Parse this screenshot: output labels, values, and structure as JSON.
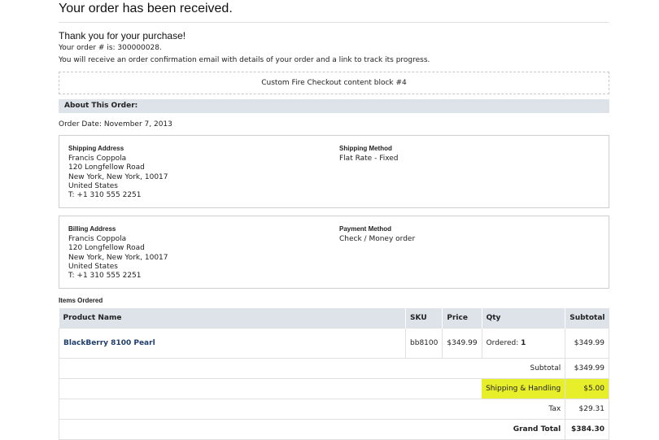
{
  "page": {
    "title": "Your order has been received.",
    "thanks": "Thank you for your purchase!",
    "order_line": "Your order # is: 300000028.",
    "email_line": "You will receive an order confirmation email with details of your order and a link to track its progress.",
    "content_block": "Custom Fire Checkout content block #4"
  },
  "about": {
    "heading": "About This Order:",
    "order_date": "Order Date: November 7, 2013"
  },
  "shipping": {
    "address_heading": "Shipping Address",
    "lines": [
      "Francis Coppola",
      "120 Longfellow Road",
      "New York, New York, 10017",
      "United States",
      "T: +1 310 555 2251"
    ],
    "method_heading": "Shipping Method",
    "method": "Flat Rate - Fixed"
  },
  "billing": {
    "address_heading": "Billing Address",
    "lines": [
      "Francis Coppola",
      "120 Longfellow Road",
      "New York, New York, 10017",
      "United States",
      "T: +1 310 555 2251"
    ],
    "method_heading": "Payment Method",
    "method": "Check / Money order"
  },
  "items": {
    "heading": "Items Ordered",
    "columns": {
      "product": "Product Name",
      "sku": "SKU",
      "price": "Price",
      "qty": "Qty",
      "subtotal": "Subtotal"
    },
    "rows": [
      {
        "product": "BlackBerry 8100 Pearl",
        "sku": "bb8100",
        "price": "$349.99",
        "qty_label": "Ordered:",
        "qty_value": "1",
        "subtotal": "$349.99"
      }
    ],
    "totals": {
      "subtotal_label": "Subtotal",
      "subtotal_value": "$349.99",
      "shipping_label": "Shipping & Handling",
      "shipping_value": "$5.00",
      "tax_label": "Tax",
      "tax_value": "$29.31",
      "grand_label": "Grand Total",
      "grand_value": "$384.30"
    },
    "highlight_color": "#e7ee2a"
  }
}
